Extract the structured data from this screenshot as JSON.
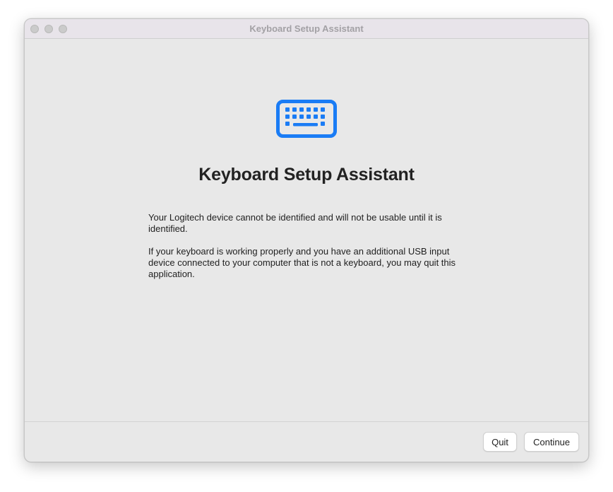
{
  "window": {
    "title": "Keyboard Setup Assistant"
  },
  "main": {
    "icon": "keyboard-icon",
    "heading": "Keyboard Setup Assistant",
    "paragraphs": [
      "Your Logitech device cannot be identified and will not be usable until it is identified.",
      "If your keyboard is working properly and you have an additional USB input device connected to your computer that is not a keyboard, you may quit this application."
    ]
  },
  "footer": {
    "quit_label": "Quit",
    "continue_label": "Continue"
  },
  "colors": {
    "accent": "#1a7cf5",
    "window_bg": "#e8e8e8"
  }
}
